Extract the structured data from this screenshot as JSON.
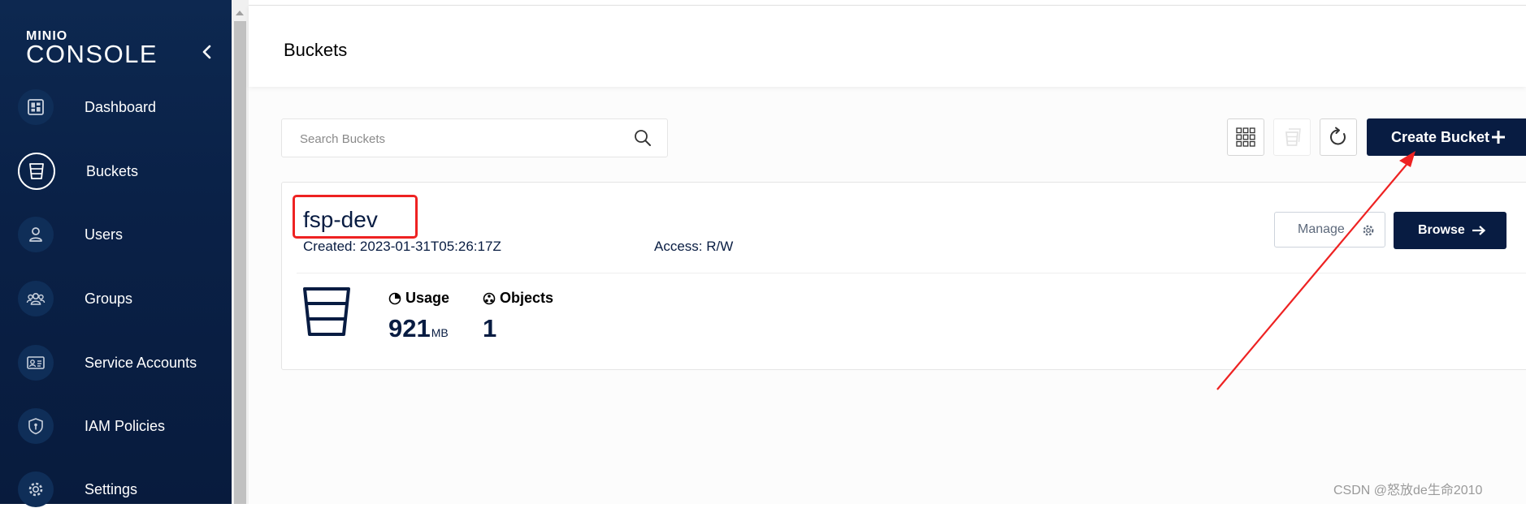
{
  "sidebar": {
    "logo_top": "MINIO",
    "logo_bottom": "CONSOLE",
    "items": [
      {
        "label": "Dashboard",
        "icon": "dashboard-icon"
      },
      {
        "label": "Buckets",
        "icon": "bucket-icon",
        "active": true
      },
      {
        "label": "Users",
        "icon": "user-icon"
      },
      {
        "label": "Groups",
        "icon": "groups-icon"
      },
      {
        "label": "Service Accounts",
        "icon": "service-accounts-icon"
      },
      {
        "label": "IAM Policies",
        "icon": "shield-icon"
      },
      {
        "label": "Settings",
        "icon": "gear-icon"
      }
    ]
  },
  "header": {
    "title": "Buckets"
  },
  "toolbar": {
    "search_placeholder": "Search Buckets",
    "create_label": "Create Bucket"
  },
  "bucket": {
    "name": "fsp-dev",
    "created": "Created: 2023-01-31T05:26:17Z",
    "access": "Access: R/W",
    "manage_label": "Manage",
    "browse_label": "Browse",
    "usage_label": "Usage",
    "usage_value": "921",
    "usage_unit": "MB",
    "objects_label": "Objects",
    "objects_value": "1"
  },
  "watermark": "CSDN @怒放de生命2010",
  "colors": {
    "sidebar_bg": "#0a2147",
    "primary": "#081c42",
    "annotation": "#ee2222"
  }
}
